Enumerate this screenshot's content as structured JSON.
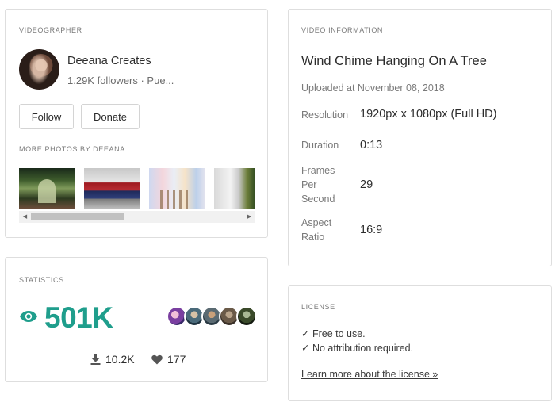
{
  "videographer": {
    "section_label": "VIDEOGRAPHER",
    "name": "Deeana Creates",
    "followers": "1.29K followers · Pue...",
    "follow_label": "Follow",
    "donate_label": "Donate",
    "more_photos_label": "MORE PHOTOS BY DEEANA",
    "scroll_left_glyph": "◀",
    "scroll_right_glyph": "▶"
  },
  "statistics": {
    "section_label": "STATISTICS",
    "views": "501K",
    "downloads": "10.2K",
    "likes": "177",
    "icons": [
      "eye-icon",
      "download-icon",
      "heart-icon"
    ]
  },
  "video_info": {
    "section_label": "VIDEO INFORMATION",
    "title": "Wind Chime Hanging On A Tree",
    "uploaded": "Uploaded at November 08, 2018",
    "resolution_label": "Resolution",
    "resolution": "1920px x 1080px (Full HD)",
    "duration_label": "Duration",
    "duration": "0:13",
    "fps_label": "Frames Per Second",
    "fps": "29",
    "aspect_label": "Aspect Ratio",
    "aspect": "16:9"
  },
  "license": {
    "section_label": "LICENSE",
    "line1": "✓ Free to use.",
    "line2": "✓ No attribution required.",
    "link": "Learn more about the license »"
  },
  "colors": {
    "accent": "#1f9e8c",
    "muted_text": "#7a7a7a",
    "border": "#dedede"
  }
}
